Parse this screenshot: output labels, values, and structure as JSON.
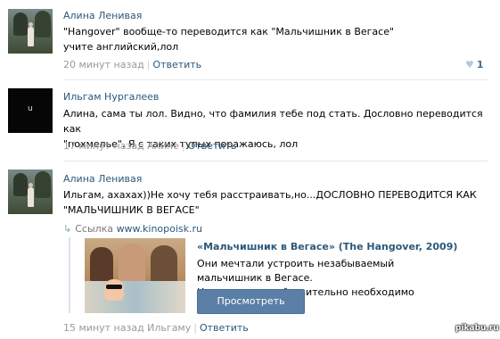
{
  "comments": [
    {
      "author": "Алина Ленивая",
      "lines": [
        "\"Hangover\" вообще-то переводится как \"Мальчишник в Вегасе\"",
        "учите английский,лол"
      ],
      "time": "20 минут назад",
      "reply": "Ответить",
      "likes": "1"
    },
    {
      "author": "Ильгам Нургалеев",
      "avatar_letter": "u",
      "lines": [
        "Алина, сама ты лол. Видно, что фамилия тебе под стать. Дословно переводится как",
        "\"похмелье\". Я с таких тупых поражаюсь, лол"
      ],
      "time": "17 минут назад Алине",
      "reply": "Ответить"
    },
    {
      "author": "Алина Ленивая",
      "lines": [
        "Ильгам, ахахах))Не хочу тебя расстраивать,но...ДОСЛОВНО ПЕРЕВОДИТСЯ КАК",
        "\"МАЛЬЧИШНИК В ВЕГАСЕ\""
      ],
      "time": "15 минут назад Ильгаму",
      "reply": "Ответить",
      "link": {
        "prefix": "Ссылка",
        "url": "www.kinopoisk.ru",
        "title": "«Мальчишник в Вегасе» (The Hangover, 2009)",
        "desc_lines": [
          "Они мечтали устроить незабываемый мальчишник в Вегасе.",
          "Но теперь им действительно необходимо вспомнить,..."
        ],
        "button": "Просмотреть"
      }
    }
  ],
  "watermark": "pikabu.ru",
  "colors": {
    "link": "#2b587a",
    "meta": "#999999",
    "button": "#5b7fa6"
  }
}
